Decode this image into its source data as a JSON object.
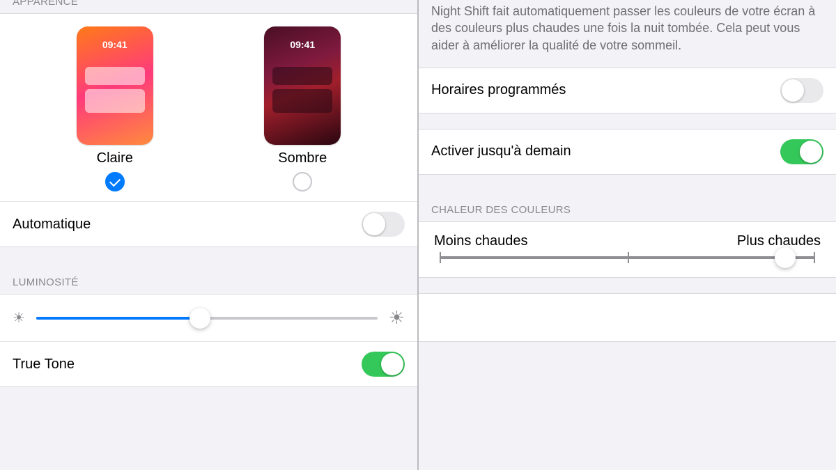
{
  "appearance": {
    "header": "Apparence",
    "light_label": "Claire",
    "dark_label": "Sombre",
    "preview_time": "09:41",
    "selected": "light",
    "automatic_label": "Automatique",
    "automatic_on": false
  },
  "brightness": {
    "header": "Luminosité",
    "value_pct": 48,
    "truetone_label": "True Tone",
    "truetone_on": true
  },
  "nightshift": {
    "description": "Night Shift fait automatiquement passer les couleurs de votre écran à des couleurs plus chaudes une fois la nuit tombée. Cela peut vous aider à améliorer la qualité de votre sommeil.",
    "scheduled_label": "Horaires programmés",
    "scheduled_on": false,
    "enable_tomorrow_label": "Activer jusqu'à demain",
    "enable_tomorrow_on": true
  },
  "warmth": {
    "header": "Chaleur des couleurs",
    "less_label": "Moins chaudes",
    "more_label": "Plus chaudes",
    "value_pct": 92
  }
}
